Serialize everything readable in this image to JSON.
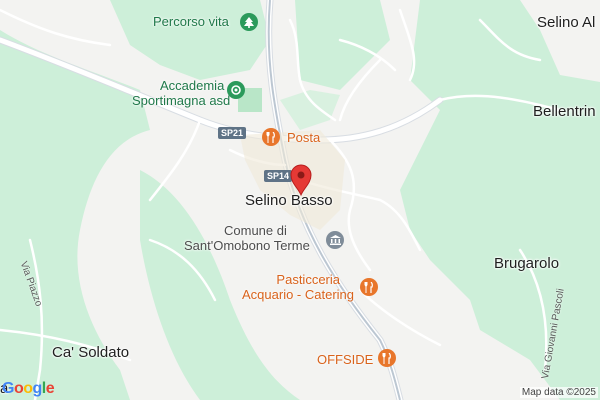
{
  "map": {
    "labels": {
      "percorso_vita": "Percorso vita",
      "accademia_line1": "Accademia",
      "accademia_line2": "Sportimagna asd",
      "posta": "Posta",
      "selino_basso": "Selino Basso",
      "comune_line1": "Comune di",
      "comune_line2": "Sant'Omobono Terme",
      "pasticceria_line1": "Pasticceria",
      "pasticceria_line2": "Acquario - Catering",
      "offside": "OFFSIDE",
      "selino_alto": "Selino Al",
      "bellentrino": "Bellentrin",
      "brugarolo": "Brugarolo",
      "ca_soldato": "Ca' Soldato",
      "bottom_left_fragment": "a"
    },
    "streets": {
      "via_piazzo": "Via Piazzo",
      "via_giovanni_pascoli": "Via Giovanni Pascoli"
    },
    "shields": {
      "sp21": "SP21",
      "sp14": "SP14"
    },
    "attribution": "Map data ©2025",
    "logo": "Google",
    "icons": {
      "park": "tree-icon",
      "sports": "sports-icon",
      "restaurant": "fork-knife-icon",
      "government": "building-icon",
      "pin": "map-pin-icon"
    },
    "colors": {
      "land": "#f3f3f1",
      "forest": "#cdefd9",
      "road": "#ffffff",
      "road_casing": "#d8dde3",
      "highway": "#bcc7d2",
      "poi_orange": "#e8762b",
      "poi_green": "#2b9a5b",
      "pin_red": "#e53935",
      "gov_grey": "#7f8c99"
    }
  }
}
